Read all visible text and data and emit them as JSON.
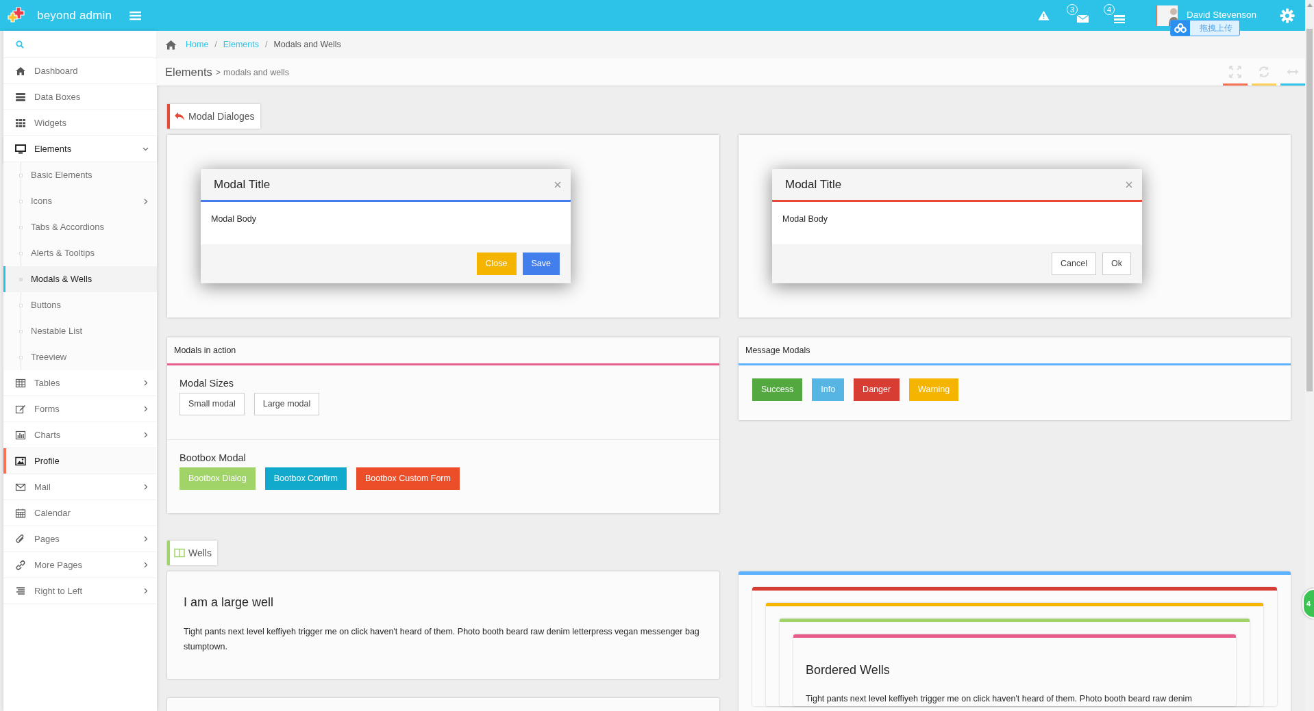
{
  "navbar": {
    "brand": "beyond admin",
    "notifications": [
      {
        "count": "3"
      },
      {
        "count": "4"
      }
    ],
    "user": {
      "name": "David Stevenson"
    },
    "upload_widget": {
      "label": "拖拽上传"
    }
  },
  "sidebar": {
    "items": [
      {
        "label": "Dashboard",
        "submenu": false,
        "expanded": false,
        "selected": false
      },
      {
        "label": "Data Boxes",
        "submenu": false,
        "expanded": false,
        "selected": false
      },
      {
        "label": "Widgets",
        "submenu": false,
        "expanded": false,
        "selected": false
      },
      {
        "label": "Elements",
        "submenu": true,
        "expanded": true,
        "selected": false,
        "children": [
          {
            "label": "Basic Elements",
            "submenu": false,
            "selected": false
          },
          {
            "label": "Icons",
            "submenu": true,
            "selected": false
          },
          {
            "label": "Tabs & Accordions",
            "submenu": false,
            "selected": false
          },
          {
            "label": "Alerts & Tooltips",
            "submenu": false,
            "selected": false
          },
          {
            "label": "Modals & Wells",
            "submenu": false,
            "selected": true
          },
          {
            "label": "Buttons",
            "submenu": false,
            "selected": false
          },
          {
            "label": "Nestable List",
            "submenu": false,
            "selected": false
          },
          {
            "label": "Treeview",
            "submenu": false,
            "selected": false
          }
        ]
      },
      {
        "label": "Tables",
        "submenu": true,
        "expanded": false,
        "selected": false
      },
      {
        "label": "Forms",
        "submenu": true,
        "expanded": false,
        "selected": false
      },
      {
        "label": "Charts",
        "submenu": true,
        "expanded": false,
        "selected": false
      },
      {
        "label": "Profile",
        "submenu": false,
        "expanded": false,
        "selected": true
      },
      {
        "label": "Mail",
        "submenu": true,
        "expanded": false,
        "selected": false
      },
      {
        "label": "Calendar",
        "submenu": false,
        "expanded": false,
        "selected": false
      },
      {
        "label": "Pages",
        "submenu": true,
        "expanded": false,
        "selected": false
      },
      {
        "label": "More Pages",
        "submenu": true,
        "expanded": false,
        "selected": false
      },
      {
        "label": "Right to Left",
        "submenu": true,
        "expanded": false,
        "selected": false
      }
    ]
  },
  "breadcrumb": {
    "separator": "/",
    "items": [
      {
        "label": "Home",
        "link": true
      },
      {
        "label": "Elements",
        "link": true
      },
      {
        "label": "Modals and Wells",
        "link": false
      }
    ]
  },
  "page_header": {
    "title": "Elements",
    "separator": ">",
    "subtitle": "modals and wells",
    "tools": [
      {
        "color": "#fb6e52"
      },
      {
        "color": "#ffce55"
      },
      {
        "color": "#2dc3e8"
      }
    ]
  },
  "modal_dialogs": {
    "header": {
      "label": "Modal Dialoges",
      "color": "#e74b37"
    },
    "modals": [
      {
        "title": "Modal Title",
        "body": "Modal Body",
        "color": "#427fed",
        "buttons": [
          {
            "label": "Close",
            "kind": "warning"
          },
          {
            "label": "Save",
            "kind": "primary"
          }
        ]
      },
      {
        "title": "Modal Title",
        "body": "Modal Body",
        "color": "#e74b37",
        "buttons": [
          {
            "label": "Cancel",
            "kind": "default"
          },
          {
            "label": "Ok",
            "kind": "default"
          }
        ]
      }
    ]
  },
  "modals_in_action": {
    "title": "Modals in action",
    "color": "#e75b8d",
    "groups": [
      {
        "title": "Modal Sizes",
        "buttons": [
          {
            "label": "Small modal",
            "kind": "default"
          },
          {
            "label": "Large modal",
            "kind": "default"
          }
        ]
      },
      {
        "title": "Bootbox Modal",
        "buttons": [
          {
            "label": "Bootbox Dialog",
            "kind": "palegreen"
          },
          {
            "label": "Bootbox Confirm",
            "kind": "sky"
          },
          {
            "label": "Bootbox Custom Form",
            "kind": "darkorange"
          }
        ]
      }
    ]
  },
  "message_modals": {
    "title": "Message Modals",
    "color": "#5db2ff",
    "buttons": [
      {
        "label": "Success",
        "kind": "success"
      },
      {
        "label": "Info",
        "kind": "info"
      },
      {
        "label": "Danger",
        "kind": "danger"
      },
      {
        "label": "Warning",
        "kind": "warning"
      }
    ]
  },
  "wells": {
    "header": {
      "label": "Wells",
      "color": "#a0d468"
    },
    "large_well": {
      "title": "I am a large well",
      "text": "Tight pants next level keffiyeh trigger me on click haven't heard of them. Photo booth beard raw denim letterpress vegan messenger bag stumptown."
    },
    "bordered_wells": {
      "layers": [
        {
          "color": "#5db2ff"
        },
        {
          "color": "#d73d32"
        },
        {
          "color": "#f4b400"
        },
        {
          "color": "#a0d468"
        },
        {
          "color": "#e75b8d"
        }
      ],
      "title": "Bordered Wells",
      "text": "Tight pants next level keffiyeh trigger me on click haven't heard of them. Photo booth beard raw denim"
    }
  },
  "chat_bubble": {
    "label": "4"
  }
}
